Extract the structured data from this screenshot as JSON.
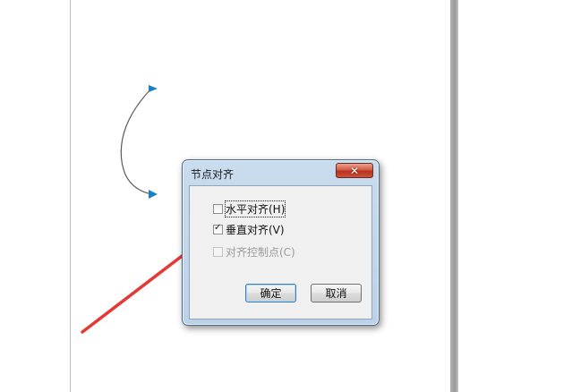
{
  "dialog": {
    "title": "节点对齐",
    "close_glyph": "✕",
    "options": [
      {
        "label": "水平对齐(H)",
        "checked": false,
        "disabled": false
      },
      {
        "label": "垂直对齐(V)",
        "checked": true,
        "disabled": false
      },
      {
        "label": "对齐控制点(C)",
        "checked": false,
        "disabled": true
      }
    ],
    "ok_label": "确定",
    "cancel_label": "取消"
  },
  "colors": {
    "curve": "#5a5a5a",
    "node_marker": "#1d7fc4",
    "annotation_arrow": "#e53935"
  },
  "icons": [
    "close-icon",
    "node-marker-icon",
    "annotation-arrow"
  ]
}
